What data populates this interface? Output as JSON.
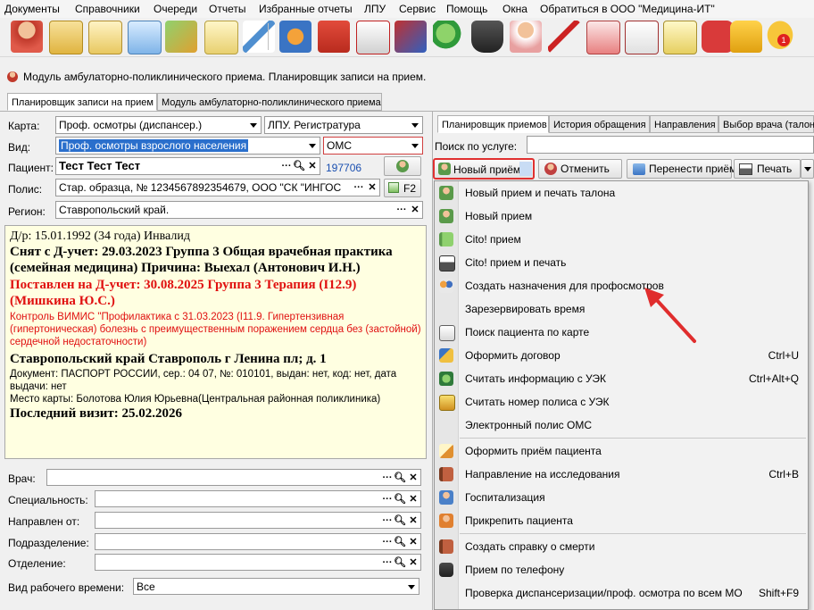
{
  "menubar": {
    "items": [
      "Документы",
      "Справочники",
      "Очереди",
      "Отчеты",
      "Избранные отчеты",
      "ЛПУ",
      "Сервис",
      "Помощь",
      "Окна",
      "Обратиться в ООО \"Медицина-ИТ\""
    ]
  },
  "toolbar": {
    "icons": [
      "doctor-icon",
      "notebook-icon",
      "card-icon",
      "id-card-icon",
      "lab-icon",
      "edit-icon",
      "syringe-icon",
      "map-icon",
      "medkit-icon",
      "first-aid-icon",
      "register-icon",
      "pills-icon",
      "scanner-icon",
      "nurse-icon",
      "thermometer-icon",
      "window-icon",
      "newspaper-icon",
      "list-icon",
      "apps-icon",
      "lock-icon",
      "chat-icon"
    ],
    "notification_count": "1"
  },
  "module_title": "Модуль амбулаторно-поликлинического приема. Планировщик записи на прием.",
  "main_tabs": [
    "Планировщик записи на прием",
    "Модуль амбулаторно-поликлинического приема"
  ],
  "form": {
    "karta_label": "Карта:",
    "karta_value": "Проф. осмотры (диспансер.)",
    "lpu_value": "ЛПУ. Регистратура",
    "vid_label": "Вид:",
    "vid_value": "Проф. осмотры взрослого населения",
    "oms_value": "ОМС",
    "patient_label": "Пациент:",
    "patient_value": "Тест Тест Тест",
    "patient_id": "197706",
    "polis_label": "Полис:",
    "polis_value": "Стар. образца, № 1234567892354679, ООО \"СК \"ИНГОС",
    "f2_label": "F2",
    "region_label": "Регион:",
    "region_value": "Ставропольский край."
  },
  "info": {
    "dob": "Д/р: 15.01.1992 (34 года) Инвалид",
    "removed": "Снят с Д-учет: 29.03.2023 Группа 3 Общая врачебная практика (семейная медицина) Причина: Выехал (Антонович И.Н.)",
    "placed": "Поставлен на Д-учет: 30.08.2025 Группа 3 Терапия (I12.9) (Мишкина Ю.С.)",
    "vimis": "Контроль ВИМИС \"Профилактика с 31.03.2023 (I11.9. Гипертензивная (гипертоническая) болезнь с преимущественным поражением сердца без (застойной) сердечной недостаточности)",
    "address": "Ставропольский край Ставрополь г Ленина пл; д. 1",
    "document": "Документ: ПАСПОРТ РОССИИ, сер.: 04 07, №: 010101, выдан: нет, код: нет, дата выдачи: нет",
    "card_place": "Место карты: Болотова Юлия Юрьевна(Центральная районная поликлиника)",
    "last_visit": "Последний визит: 25.02.2026"
  },
  "filters": {
    "vrach": "Врач:",
    "spec": "Специальность:",
    "napr": "Направлен от:",
    "podr": "Подразделение:",
    "otd": "Отделение:",
    "work_time_label": "Вид рабочего времени:",
    "work_time_value": "Все"
  },
  "right_tabs": [
    "Планировщик приемов",
    "История обращения",
    "Направления",
    "Выбор врача (талон"
  ],
  "search_label": "Поиск по услуге:",
  "actions": {
    "new": "Новый приём",
    "cancel": "Отменить",
    "move": "Перенести приём",
    "print": "Печать"
  },
  "menu": [
    {
      "label": "Новый прием и печать талона",
      "shortcut": "",
      "icon": "doctor-icon"
    },
    {
      "label": "Новый прием",
      "shortcut": "",
      "icon": "doctor-icon"
    },
    {
      "label": "Cito! прием",
      "shortcut": "",
      "icon": "flag-icon"
    },
    {
      "label": "Cito! прием и печать",
      "shortcut": "",
      "icon": "printer-icon"
    },
    {
      "label": "Создать назначения для профосмотров",
      "shortcut": "",
      "icon": "people-icon"
    },
    {
      "label": "Зарезервировать время",
      "shortcut": "",
      "icon": ""
    },
    {
      "label": "Поиск пациента по карте",
      "shortcut": "",
      "icon": "search-doc-icon"
    },
    {
      "label": "Оформить договор",
      "shortcut": "Ctrl+U",
      "icon": "contract-icon"
    },
    {
      "label": "Считать информацию с УЭК",
      "shortcut": "Ctrl+Alt+Q",
      "icon": "card-reader-icon"
    },
    {
      "label": "Считать номер полиса с УЭК",
      "shortcut": "",
      "icon": "card-icon"
    },
    {
      "label": "Электронный полис ОМС",
      "shortcut": "",
      "icon": ""
    },
    {
      "label": "Оформить приём пациента",
      "shortcut": "",
      "icon": "edit-icon"
    },
    {
      "label": "Направление на исследования",
      "shortcut": "Ctrl+B",
      "icon": "book-icon"
    },
    {
      "label": "Госпитализация",
      "shortcut": "",
      "icon": "hospital-icon"
    },
    {
      "label": "Прикрепить пациента",
      "shortcut": "",
      "icon": "attach-icon"
    },
    {
      "label": "Создать справку о смерти",
      "shortcut": "",
      "icon": "certificate-icon"
    },
    {
      "label": "Прием по телефону",
      "shortcut": "",
      "icon": "phone-icon"
    },
    {
      "label": "Проверка диспансеризации/проф. осмотра по всем МО",
      "shortcut": "Shift+F9",
      "icon": ""
    }
  ]
}
